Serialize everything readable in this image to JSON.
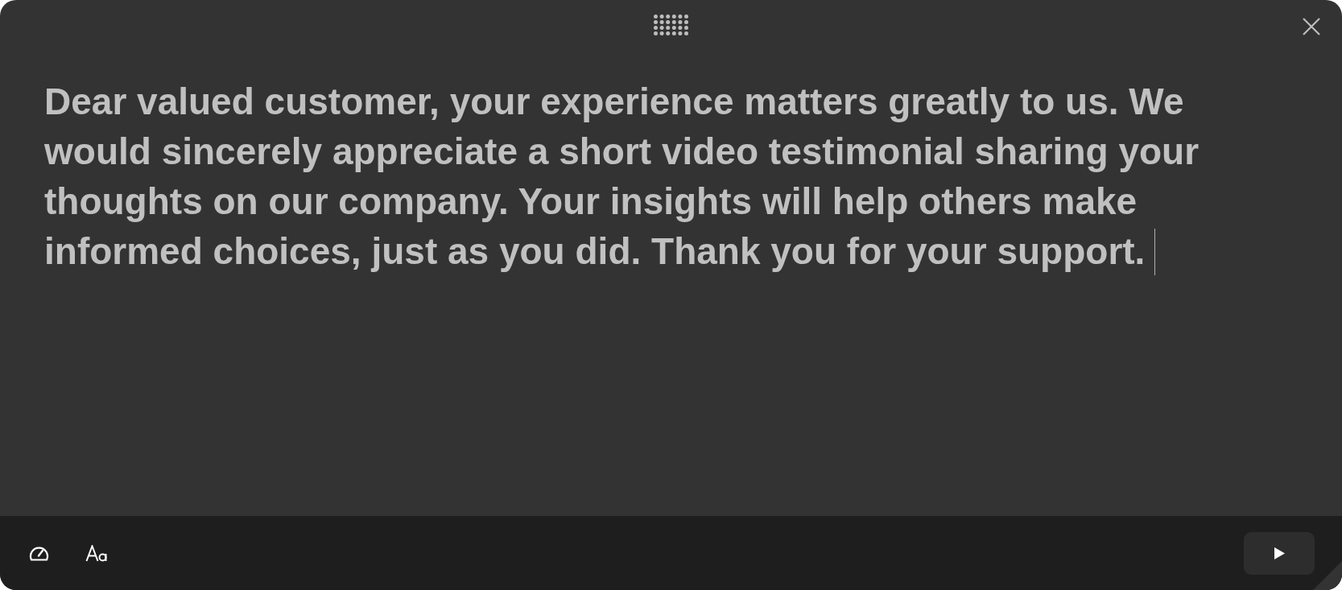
{
  "editor": {
    "text": "Dear valued customer, your experience matters greatly to us. We would sincerely appreciate a short video testimonial sharing your thoughts on our company. Your insights will help others make informed choices, just as you did. Thank you for your support.",
    "focused": true
  },
  "toolbar": {
    "tools": [
      {
        "kind": "speed"
      },
      {
        "kind": "font"
      }
    ]
  },
  "playback": {
    "playing": false
  }
}
